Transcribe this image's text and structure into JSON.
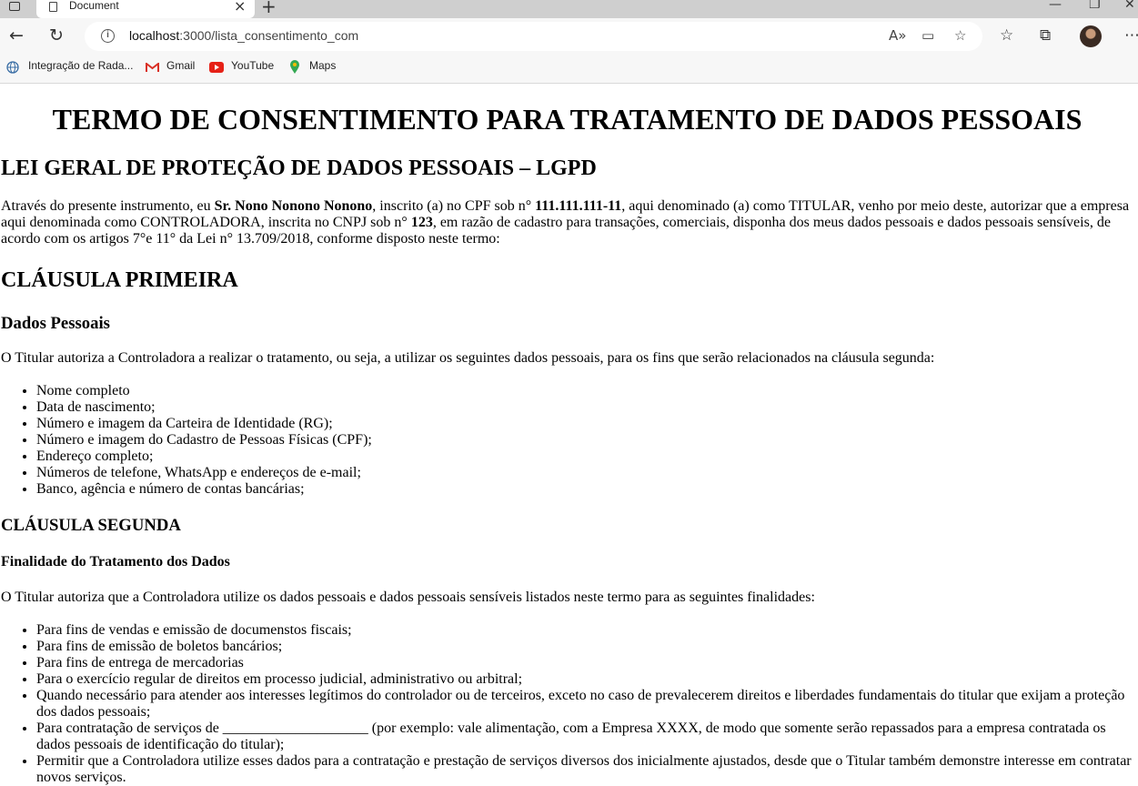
{
  "browser": {
    "tab_title": "Document",
    "url_host": "localhost",
    "url_path": ":3000/lista_consentimento_com",
    "bookmarks": [
      {
        "label": "Integração de Rada...",
        "icon": "globe-icon"
      },
      {
        "label": "Gmail",
        "icon": "gmail-icon"
      },
      {
        "label": "YouTube",
        "icon": "youtube-icon"
      },
      {
        "label": "Maps",
        "icon": "maps-icon"
      }
    ]
  },
  "doc": {
    "title": "TERMO DE CONSENTIMENTO PARA TRATAMENTO DE DADOS PESSOAIS",
    "law": "LEI GERAL DE PROTEÇÃO DE DADOS PESSOAIS – LGPD",
    "intro": {
      "p1": "Através do presente instrumento, eu ",
      "name": "Sr. Nono Nonono Nonono",
      "p2": ", inscrito (a) no CPF sob n° ",
      "cpf": "111.111.111-11",
      "p3": ", aqui denominado (a) como TITULAR, venho por meio deste, autorizar que a empresa aqui denominada como CONTROLADORA, inscrita no CNPJ sob n° ",
      "cnpj": "123",
      "p4": ", em razão de cadastro para transações, comerciais, disponha dos meus dados pessoais e dados pessoais sensíveis, de acordo com os artigos 7°e 11° da Lei n° 13.709/2018, conforme disposto neste termo:"
    },
    "clause1": {
      "heading": "CLÁUSULA PRIMEIRA",
      "subheading": "Dados Pessoais",
      "text": "O Titular autoriza a Controladora a realizar o tratamento, ou seja, a utilizar os seguintes dados pessoais, para os fins que serão relacionados na cláusula segunda:",
      "items": [
        "Nome completo",
        "Data de nascimento;",
        "Número e imagem da Carteira de Identidade (RG);",
        "Número e imagem do Cadastro de Pessoas Físicas (CPF);",
        "Endereço completo;",
        "Números de telefone, WhatsApp e endereços de e-mail;",
        "Banco, agência e número de contas bancárias;"
      ]
    },
    "clause2": {
      "heading": "CLÁUSULA SEGUNDA",
      "subheading": "Finalidade do Tratamento dos Dados",
      "text": "O Titular autoriza que a Controladora utilize os dados pessoais e dados pessoais sensíveis listados neste termo para as seguintes finalidades:",
      "items": [
        "Para fins de vendas e emissão de documenstos fiscais;",
        "Para fins de emissão de boletos bancários;",
        "Para fins de entrega de mercadorias",
        "Para o exercício regular de direitos em processo judicial, administrativo ou arbitral;",
        "Quando necessário para atender aos interesses legítimos do controlador ou de terceiros, exceto no caso de prevalecerem direitos e liberdades fundamentais do titular que exijam a proteção dos dados pessoais;",
        "Para contratação de serviços de ____________________ (por exemplo: vale alimentação, com a Empresa XXXX, de modo que somente serão repassados para a empresa contratada os dados pessoais de identificação do titular);",
        "Permitir que a Controladora utilize esses dados para a contratação e prestação de serviços diversos dos inicialmente ajustados, desde que o Titular também demonstre interesse em contratar novos serviços."
      ]
    }
  }
}
